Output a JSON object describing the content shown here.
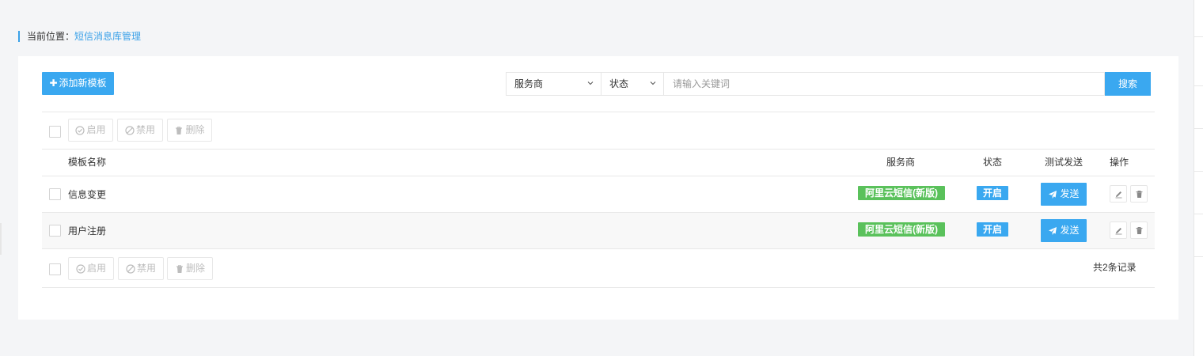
{
  "breadcrumb": {
    "prefix": "当前位置：",
    "current": "短信消息库管理"
  },
  "toolbar": {
    "add_label": "添加新模板",
    "add_icon": "plus-icon"
  },
  "search": {
    "provider_select": "服务商",
    "status_select": "状态",
    "keyword_placeholder": "请输入关键词",
    "keyword_value": "",
    "search_label": "搜索"
  },
  "bulk_actions": {
    "enable_label": "启用",
    "disable_label": "禁用",
    "delete_label": "删除"
  },
  "table": {
    "headers": {
      "name": "模板名称",
      "provider": "服务商",
      "status": "状态",
      "test_send": "测试发送",
      "actions": "操作"
    },
    "rows": [
      {
        "name": "信息变更",
        "provider": "阿里云短信(新版)",
        "status": "开启",
        "send_label": "发送"
      },
      {
        "name": "用户注册",
        "provider": "阿里云短信(新版)",
        "status": "开启",
        "send_label": "发送"
      }
    ]
  },
  "footer": {
    "total": "共2条记录"
  },
  "colors": {
    "primary": "#3aa8f0",
    "success": "#5ac15b",
    "breadcrumb_accent": "#3aa1e8"
  }
}
